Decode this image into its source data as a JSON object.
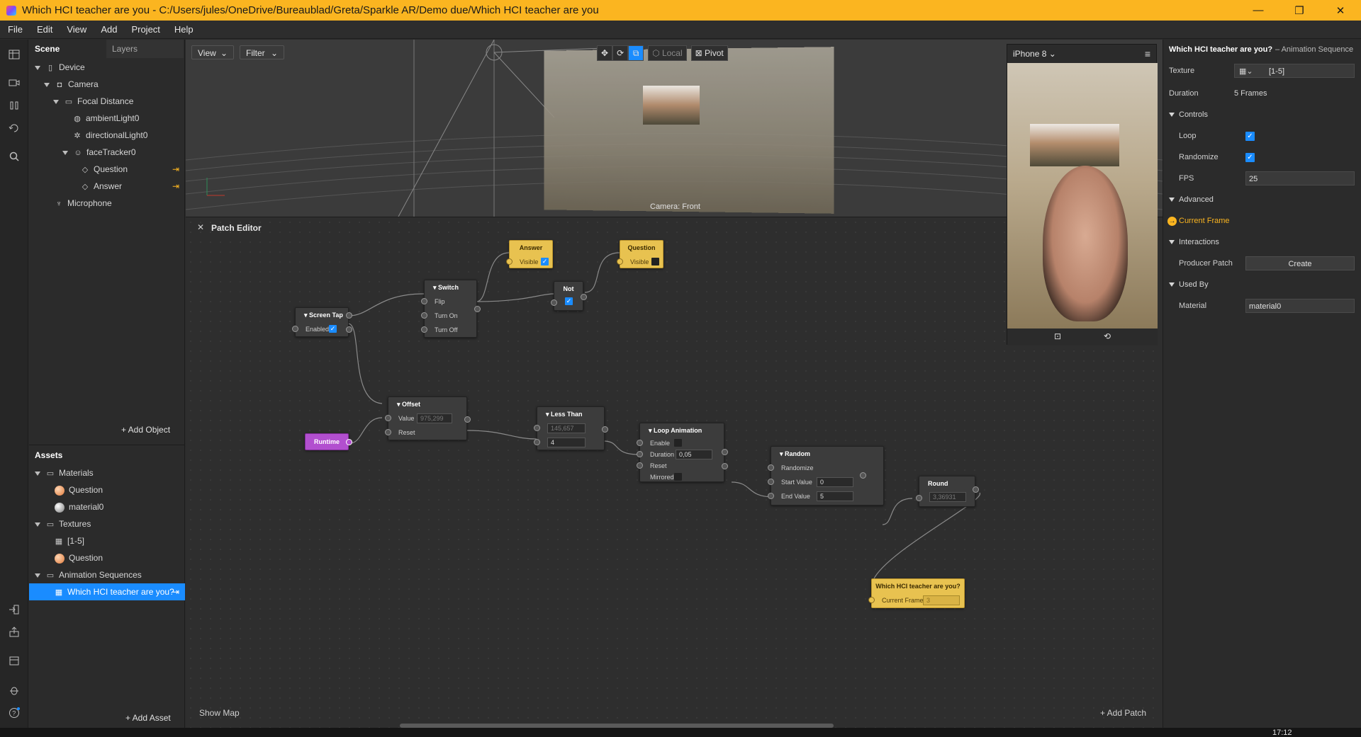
{
  "window": {
    "title": "Which HCI teacher are you - C:/Users/jules/OneDrive/Bureaublad/Greta/Sparkle AR/Demo due/Which HCI teacher are you",
    "minimize": "—",
    "maximize": "❐",
    "close": "✕"
  },
  "menu": [
    "File",
    "Edit",
    "View",
    "Add",
    "Project",
    "Help"
  ],
  "scene": {
    "tab_scene": "Scene",
    "tab_layers": "Layers",
    "items": [
      {
        "label": "Device"
      },
      {
        "label": "Camera"
      },
      {
        "label": "Focal Distance"
      },
      {
        "label": "ambientLight0"
      },
      {
        "label": "directionalLight0"
      },
      {
        "label": "faceTracker0"
      },
      {
        "label": "Question"
      },
      {
        "label": "Answer"
      },
      {
        "label": "Microphone"
      }
    ],
    "add_object": "+ Add Object"
  },
  "assets": {
    "title": "Assets",
    "items": [
      {
        "label": "Materials"
      },
      {
        "label": "Question"
      },
      {
        "label": "material0"
      },
      {
        "label": "Textures"
      },
      {
        "label": "[1-5]"
      },
      {
        "label": "Question"
      },
      {
        "label": "Animation Sequences"
      },
      {
        "label": "Which HCI teacher are you?"
      }
    ],
    "add_asset": "+ Add Asset"
  },
  "viewport": {
    "view": "View",
    "filter": "Filter",
    "local": "Local",
    "pivot": "Pivot",
    "camera_label": "Camera: Front"
  },
  "patch_editor": {
    "title": "Patch Editor",
    "show_map": "Show Map",
    "add_patch": "+ Add Patch",
    "nodes": {
      "answer": {
        "title": "Answer",
        "visible": "Visible"
      },
      "question": {
        "title": "Question",
        "visible": "Visible"
      },
      "switch": {
        "title": "Switch",
        "flip": "Flip",
        "turn_on": "Turn On",
        "turn_off": "Turn Off"
      },
      "not": {
        "title": "Not"
      },
      "screen_tap": {
        "title": "Screen Tap",
        "enabled": "Enabled"
      },
      "runtime": {
        "title": "Runtime"
      },
      "offset": {
        "title": "Offset",
        "value": "Value",
        "value_num": "975,299",
        "reset": "Reset"
      },
      "less_than": {
        "title": "Less Than",
        "a": "145,657",
        "b": "4"
      },
      "loop_animation": {
        "title": "Loop Animation",
        "enable": "Enable",
        "duration": "Duration",
        "duration_val": "0,05",
        "reset": "Reset",
        "mirrored": "Mirrored"
      },
      "random": {
        "title": "Random",
        "randomize": "Randomize",
        "start_value": "Start Value",
        "start_val": "0",
        "end_value": "End Value",
        "end_val": "5"
      },
      "round": {
        "title": "Round",
        "value": "3,36931"
      },
      "sequence": {
        "title": "Which HCI teacher are you?",
        "current_frame": "Current Frame",
        "frame_val": "3"
      }
    }
  },
  "preview": {
    "device": "iPhone 8"
  },
  "inspector": {
    "title": "Which HCI teacher are you?",
    "subtitle": "– Animation Sequence",
    "texture_label": "Texture",
    "texture_value": "[1-5]",
    "duration_label": "Duration",
    "duration_value": "5 Frames",
    "controls": "Controls",
    "loop": "Loop",
    "randomize": "Randomize",
    "fps": "FPS",
    "fps_value": "25",
    "advanced": "Advanced",
    "current_frame": "Current Frame",
    "interactions": "Interactions",
    "producer_patch": "Producer Patch",
    "create": "Create",
    "used_by": "Used By",
    "material": "Material",
    "material_value": "material0"
  },
  "taskbar": {
    "clock": "17:12"
  },
  "colors": {
    "accent": "#1a8cff",
    "titlebar": "#fbb520",
    "patch_yellow": "#e8c250",
    "patch_purple": "#b24fcf"
  }
}
